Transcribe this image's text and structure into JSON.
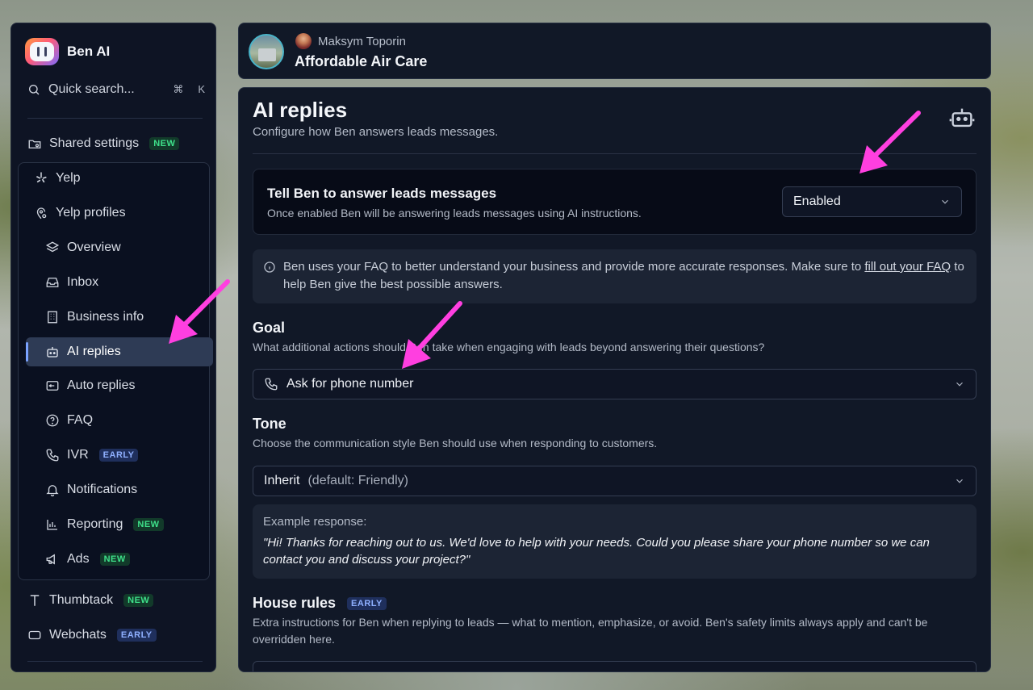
{
  "sidebar": {
    "brand": "Ben AI",
    "search_label": "Quick search...",
    "search_kbd_cmd": "⌘",
    "search_kbd_key": "K",
    "items": [
      {
        "label": "Shared settings",
        "badge": "NEW",
        "icon": "folder-gear-icon"
      },
      {
        "label": "Yelp",
        "badge": "",
        "icon": "yelp-icon"
      },
      {
        "label": "Yelp profiles",
        "badge": "",
        "icon": "map-pin-gear-icon"
      },
      {
        "label": "Overview",
        "badge": "",
        "icon": "layers-icon"
      },
      {
        "label": "Inbox",
        "badge": "",
        "icon": "inbox-icon"
      },
      {
        "label": "Business info",
        "badge": "",
        "icon": "building-icon"
      },
      {
        "label": "AI replies",
        "badge": "",
        "icon": "robot-icon"
      },
      {
        "label": "Auto replies",
        "badge": "",
        "icon": "auto-reply-icon"
      },
      {
        "label": "FAQ",
        "badge": "",
        "icon": "question-icon"
      },
      {
        "label": "IVR",
        "badge": "EARLY",
        "icon": "phone-icon"
      },
      {
        "label": "Notifications",
        "badge": "",
        "icon": "bell-icon"
      },
      {
        "label": "Reporting",
        "badge": "NEW",
        "icon": "chart-icon"
      },
      {
        "label": "Ads",
        "badge": "NEW",
        "icon": "megaphone-icon"
      },
      {
        "label": "Thumbtack",
        "badge": "NEW",
        "icon": "thumbtack-icon"
      },
      {
        "label": "Webchats",
        "badge": "EARLY",
        "icon": "chat-icon"
      }
    ],
    "active_item": "AI replies"
  },
  "header": {
    "user_name": "Maksym Toporin",
    "business_name": "Affordable Air Care"
  },
  "main": {
    "title": "AI replies",
    "subtitle": "Configure how Ben answers leads messages.",
    "toggle": {
      "title": "Tell Ben to answer leads messages",
      "description": "Once enabled Ben will be answering leads messages using AI instructions.",
      "value": "Enabled"
    },
    "info": {
      "text_before": "Ben uses your FAQ to better understand your business and provide more accurate responses. Make sure to ",
      "link_text": "fill out your FAQ",
      "text_after": " to help Ben give the best possible answers."
    },
    "goal": {
      "label": "Goal",
      "help": "What additional actions should Ben take when engaging with leads beyond answering their questions?",
      "value": "Ask for phone number"
    },
    "tone": {
      "label": "Tone",
      "help": "Choose the communication style Ben should use when responding to customers.",
      "value": "Inherit",
      "default_hint": "(default: Friendly)"
    },
    "example": {
      "label": "Example response:",
      "text": "\"Hi! Thanks for reaching out to us. We'd love to help with your needs. Could you please share your phone number so we can contact you and discuss your project?\""
    },
    "house_rules": {
      "label": "House rules",
      "badge": "EARLY",
      "help": "Extra instructions for Ben when replying to leads — what to mention, emphasize, or avoid. Ben's safety limits always apply and can't be overridden here."
    }
  },
  "colors": {
    "accent_arrow": "#ff3fe0",
    "badge_new": "#3ee08a",
    "badge_early": "#8fb0ff",
    "active_item_bg": "#2e3b55"
  }
}
